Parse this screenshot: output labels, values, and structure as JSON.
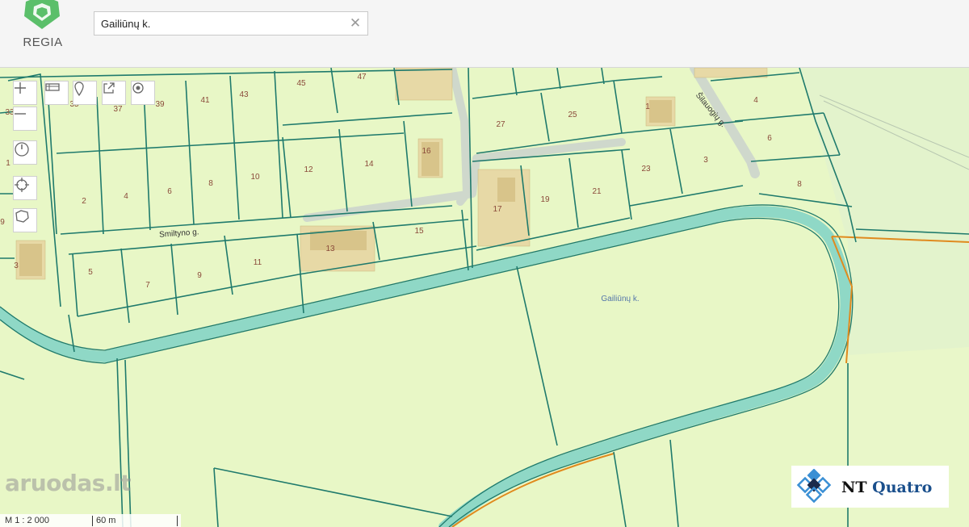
{
  "app": {
    "logo_text": "REGIA"
  },
  "search": {
    "value": "Gailiūnų k.",
    "placeholder": ""
  },
  "map": {
    "place_label": "Gailiūnų k.",
    "streets": [
      "Smiltyno g.",
      "Šilauogių g."
    ],
    "lot_numbers": [
      "33",
      "35",
      "37",
      "39",
      "41",
      "43",
      "45",
      "47",
      "1",
      "2",
      "4",
      "6",
      "8",
      "10",
      "12",
      "14",
      "16",
      "3",
      "5",
      "7",
      "9",
      "11",
      "13",
      "15",
      "17",
      "19",
      "21",
      "23",
      "25",
      "27",
      "1",
      "3",
      "4",
      "6",
      "8",
      "9"
    ],
    "colors": {
      "land": "#e8f7c6",
      "parcel_line": "#1f7a6c",
      "road_buffer": "#8fd8c6",
      "building": "#e7d9a6",
      "boundary": "#e08a1e"
    }
  },
  "toolbar": {
    "zoom_in_icon": "plus-icon",
    "zoom_out_icon": "minus-icon",
    "layers_icon": "layers-icon",
    "marker_icon": "marker-icon",
    "share_icon": "share-icon",
    "target_icon": "target-icon",
    "compass_icon": "compass-icon",
    "locate_icon": "crosshair-icon",
    "area_icon": "polygon-icon"
  },
  "watermark": {
    "text": "aruodas.lt"
  },
  "scale": {
    "ratio": "M 1 : 2 000",
    "distance": "60 m"
  },
  "agency": {
    "name_prefix": "NT",
    "name_suffix": "Quatro"
  }
}
